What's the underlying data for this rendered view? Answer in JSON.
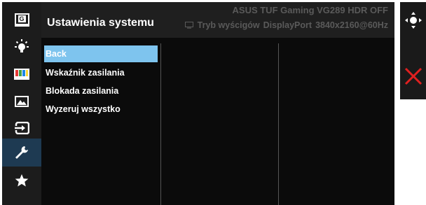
{
  "header": {
    "title": "Ustawienia systemu",
    "model": "ASUS TUF Gaming VG289 HDR OFF",
    "status_items": [
      "Tryb wyścigów",
      "DisplayPort",
      "3840x2160@60Hz"
    ]
  },
  "sidebar": {
    "g_icon_text": "G",
    "items": [
      {
        "name": "gaming",
        "icon": "gamevisual-g-icon"
      },
      {
        "name": "blue-light",
        "icon": "bulb-icon"
      },
      {
        "name": "color",
        "icon": "color-bars-icon"
      },
      {
        "name": "image",
        "icon": "image-icon"
      },
      {
        "name": "input",
        "icon": "input-select-icon"
      },
      {
        "name": "system",
        "icon": "wrench-icon",
        "active": true
      },
      {
        "name": "favorite",
        "icon": "star-icon"
      }
    ]
  },
  "menu": {
    "items": [
      "Back",
      "Wskaźnik zasilania",
      "Blokada zasilania",
      "Wyzeruj wszystko"
    ],
    "selected_index": 0
  },
  "controls": {
    "icons": [
      "navigation-joystick-icon",
      "close-icon"
    ]
  },
  "colors": {
    "selected": "#7ec4ee",
    "active_sidebar": "#1e3a52",
    "close": "#e02020"
  }
}
